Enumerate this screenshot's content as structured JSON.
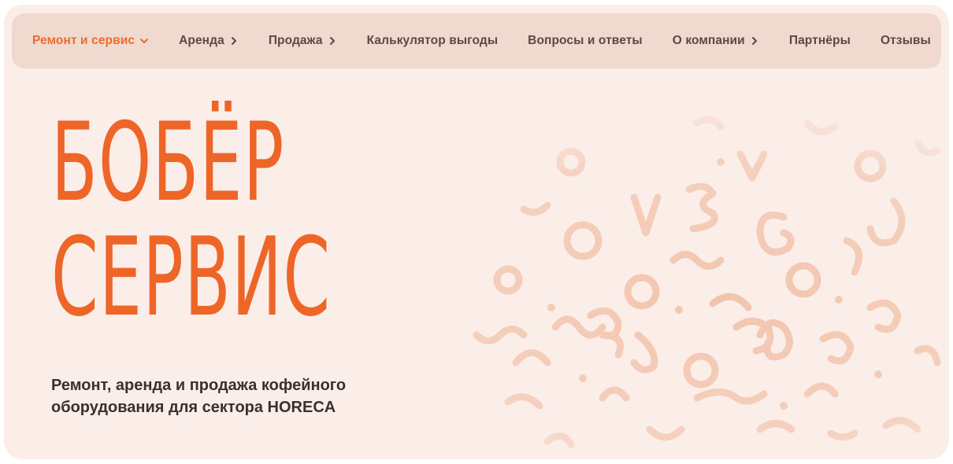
{
  "nav": {
    "items": [
      {
        "label": "Ремонт и сервис",
        "chevron": "chevron-down-icon",
        "active": true
      },
      {
        "label": "Аренда",
        "chevron": "chevron-right-icon"
      },
      {
        "label": "Продажа",
        "chevron": "chevron-right-icon"
      },
      {
        "label": "Калькулятор выгоды",
        "chevron": null
      },
      {
        "label": "Вопросы и ответы",
        "chevron": null
      },
      {
        "label": "О компании",
        "chevron": "chevron-right-icon"
      },
      {
        "label": "Партнёры",
        "chevron": null
      },
      {
        "label": "Отзывы",
        "chevron": null
      }
    ]
  },
  "hero": {
    "title_line1": "БОБЁР",
    "title_line2": "СЕРВИС",
    "subtitle": "Ремонт, аренда и продажа кофейного оборудования для сектора HORECA"
  },
  "colors": {
    "accent": "#ee6528",
    "nav_bg": "#f0d9cf",
    "hero_bg": "#fbeee9",
    "text_dark": "#3b302d",
    "pattern": "#f2c4ad"
  }
}
